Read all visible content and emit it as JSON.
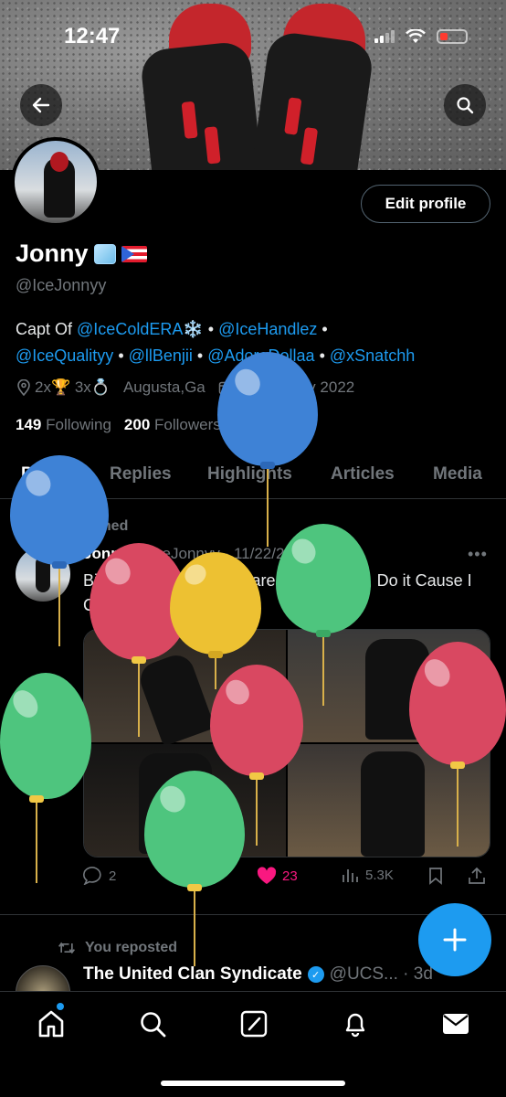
{
  "status_bar": {
    "time": "12:47"
  },
  "profile": {
    "display_name": "Jonny",
    "handle": "@IceJonnyy",
    "edit_button": "Edit profile",
    "bio": {
      "prefix": "Capt Of ",
      "mention1": "@IceColdERA",
      "snow": "❄️",
      "sep1": " • ",
      "mention2": "@IceHandlez",
      "sep2": " •",
      "mention3": "@IceQualityy",
      "sep3": " • ",
      "mention4": "@llBenjii",
      "sep4": " • ",
      "mention5": "@AdoreDollaa",
      "sep5": " • ",
      "mention6": "@xSnatchh"
    },
    "meta": {
      "awards": "2x🏆 3x💍",
      "location": "Augusta,Ga",
      "joined": "Joined May 2022"
    },
    "following_count": "149",
    "following_label": "Following",
    "followers_count": "200",
    "followers_label": "Followers"
  },
  "tabs": [
    {
      "label": "Posts"
    },
    {
      "label": "Replies"
    },
    {
      "label": "Highlights"
    },
    {
      "label": "Articles"
    },
    {
      "label": "Media"
    }
  ],
  "pinned_tweet": {
    "pinned_label": "Pinned",
    "author": "Jonny",
    "handle_date": "@IceJonnyy · 11/22/23",
    "text": "Big Balenci..., I Don't Care For Fashion, Do it Cause I Can 🥶💫",
    "replies": "2",
    "reposts": "11",
    "likes": "23",
    "views": "5.3K"
  },
  "repost": {
    "label": "You reposted",
    "author": "The United Clan Syndicate",
    "handle_date": "@UCS... · 3d"
  },
  "colors": {
    "accent": "#1d9bf0",
    "like": "#f91880",
    "background": "#000000",
    "muted": "#71767b"
  },
  "icons": [
    "back-arrow-icon",
    "search-icon",
    "location-pin-icon",
    "calendar-icon",
    "pin-icon",
    "reply-icon",
    "repost-icon",
    "heart-icon",
    "views-icon",
    "bookmark-icon",
    "share-icon",
    "plus-icon",
    "home-icon",
    "compose-icon",
    "bell-icon",
    "mail-icon",
    "verified-badge-icon"
  ]
}
